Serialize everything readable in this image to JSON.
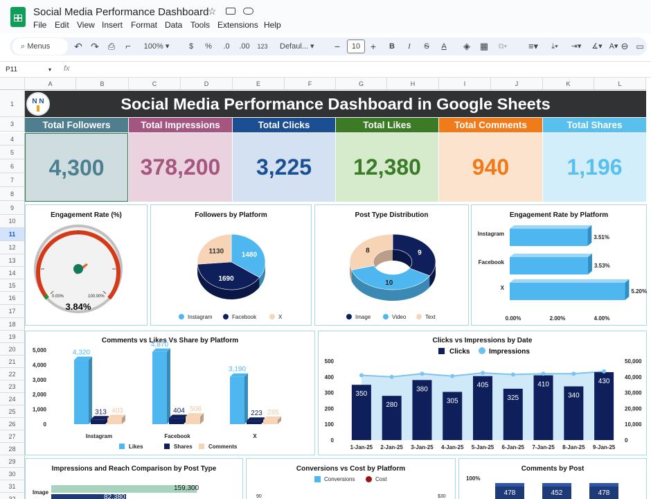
{
  "app": {
    "doc_title": "Social Media Performance Dashboard"
  },
  "menus": [
    "File",
    "Edit",
    "View",
    "Insert",
    "Format",
    "Data",
    "Tools",
    "Extensions",
    "Help"
  ],
  "toolbar": {
    "search": "Menus",
    "zoom": "100%",
    "currency": "$",
    "percent": "%",
    "dec_dec": ".0",
    "inc_dec": ".00",
    "num_fmt": "123",
    "font": "Defaul...",
    "font_size": "10",
    "bold": "B",
    "italic": "I"
  },
  "formula_bar": {
    "cell_ref": "P11",
    "fx": "fx",
    "value": ""
  },
  "columns": [
    "A",
    "B",
    "C",
    "D",
    "E",
    "F",
    "G",
    "H",
    "I",
    "J",
    "K",
    "L"
  ],
  "rows": [
    "1",
    "3",
    "4",
    "5",
    "6",
    "7",
    "8",
    "9",
    "10",
    "11",
    "12",
    "13",
    "14",
    "15",
    "16",
    "17",
    "18",
    "19",
    "20",
    "21",
    "22",
    "23",
    "24",
    "25",
    "26",
    "27",
    "28",
    "29",
    "30",
    "31",
    "32",
    "33",
    "34"
  ],
  "dashboard_title": "Social Media Performance Dashboard in Google Sheets",
  "logo_text": "N N",
  "kpis": [
    {
      "label": "Total Followers",
      "value": "4,300",
      "head_color": "#4f7f8f",
      "body_color": "#cfdde0",
      "value_color": "#4c7f8f"
    },
    {
      "label": "Total Impressions",
      "value": "378,200",
      "head_color": "#a45580",
      "body_color": "#ead3de",
      "value_color": "#a4567f"
    },
    {
      "label": "Total Clicks",
      "value": "3,225",
      "head_color": "#1b4e93",
      "body_color": "#d4e1f3",
      "value_color": "#1b4f93"
    },
    {
      "label": "Total Likes",
      "value": "12,380",
      "head_color": "#3b7b26",
      "body_color": "#d6ebcc",
      "value_color": "#3b7a26"
    },
    {
      "label": "Total Comments",
      "value": "940",
      "head_color": "#f07b1a",
      "body_color": "#fbe3cd",
      "value_color": "#f07a1a"
    },
    {
      "label": "Total Shares",
      "value": "1,196",
      "head_color": "#59c0ee",
      "body_color": "#d2eefb",
      "value_color": "#59c0ee"
    }
  ],
  "charts": {
    "gauge": {
      "title": "Engagement Rate (%)",
      "min_label": "0.00%",
      "max_label": "100.00%",
      "value_label": "3.84%"
    },
    "followers_pie": {
      "title": "Followers by Platform",
      "legend": [
        "Instagram",
        "Facebook",
        "X"
      ]
    },
    "post_type": {
      "title": "Post Type Distribution",
      "legend": [
        "Image",
        "Video",
        "Text"
      ]
    },
    "eng_platform": {
      "title": "Engagement Rate by Platform",
      "axis": [
        "0.00%",
        "2.00%",
        "4.00%"
      ]
    },
    "cls": {
      "title": "Comments vs Likes Vs Share by Platform",
      "legend": [
        "Likes",
        "Shares",
        "Comments"
      ],
      "yticks": [
        "5,000",
        "4,000",
        "3,000",
        "2,000",
        "1,000",
        "0"
      ]
    },
    "ci": {
      "title": "Clicks vs Impressions by Date",
      "legend": [
        "Clicks",
        "Impressions"
      ],
      "yleft": [
        "500",
        "400",
        "300",
        "200",
        "100",
        "0"
      ],
      "yright": [
        "50,000",
        "40,000",
        "30,000",
        "20,000",
        "10,000",
        "0"
      ]
    },
    "irc": {
      "title": "Impressions and Reach Comparison by Post Type",
      "row_label": "Image",
      "value": "159,300",
      "value2": "82,380"
    },
    "conv": {
      "title": "Conversions vs Cost by Platform",
      "legend": [
        "Conversions",
        "Cost"
      ],
      "y_left": "90",
      "y_right": "$30"
    },
    "cbp": {
      "title": "Comments by Post",
      "y": "100%",
      "bars": [
        "478",
        "452",
        "478"
      ]
    }
  },
  "chart_data": [
    {
      "type": "pie",
      "title": "Followers by Platform",
      "categories": [
        "Instagram",
        "Facebook",
        "X"
      ],
      "values": [
        1480,
        1690,
        1130
      ]
    },
    {
      "type": "pie",
      "title": "Post Type Distribution",
      "categories": [
        "Image",
        "Video",
        "Text"
      ],
      "values": [
        9,
        10,
        8
      ]
    },
    {
      "type": "bar",
      "title": "Engagement Rate by Platform",
      "categories": [
        "Instagram",
        "Facebook",
        "X"
      ],
      "values": [
        3.51,
        3.53,
        5.2
      ],
      "xlim": [
        0,
        5
      ]
    },
    {
      "type": "bar",
      "title": "Comments vs Likes Vs Share by Platform",
      "categories": [
        "Instagram",
        "Facebook",
        "X"
      ],
      "series": [
        {
          "name": "Likes",
          "values": [
            4320,
            4870,
            3190
          ]
        },
        {
          "name": "Shares",
          "values": [
            313,
            404,
            223
          ]
        },
        {
          "name": "Comments",
          "values": [
            403,
            508,
            285
          ]
        }
      ],
      "ylim": [
        0,
        5000
      ]
    },
    {
      "type": "bar",
      "title": "Clicks vs Impressions by Date",
      "categories": [
        "1-Jan-25",
        "2-Jan-25",
        "3-Jan-25",
        "4-Jan-25",
        "5-Jan-25",
        "6-Jan-25",
        "7-Jan-25",
        "8-Jan-25",
        "9-Jan-25"
      ],
      "series": [
        {
          "name": "Clicks",
          "values": [
            350,
            280,
            380,
            305,
            405,
            325,
            410,
            340,
            430
          ]
        },
        {
          "name": "Impressions",
          "values": [
            41000,
            40000,
            42000,
            40500,
            42500,
            41500,
            42000,
            42000,
            43500
          ]
        }
      ],
      "ylim": [
        0,
        500
      ],
      "y2lim": [
        0,
        50000
      ]
    }
  ]
}
